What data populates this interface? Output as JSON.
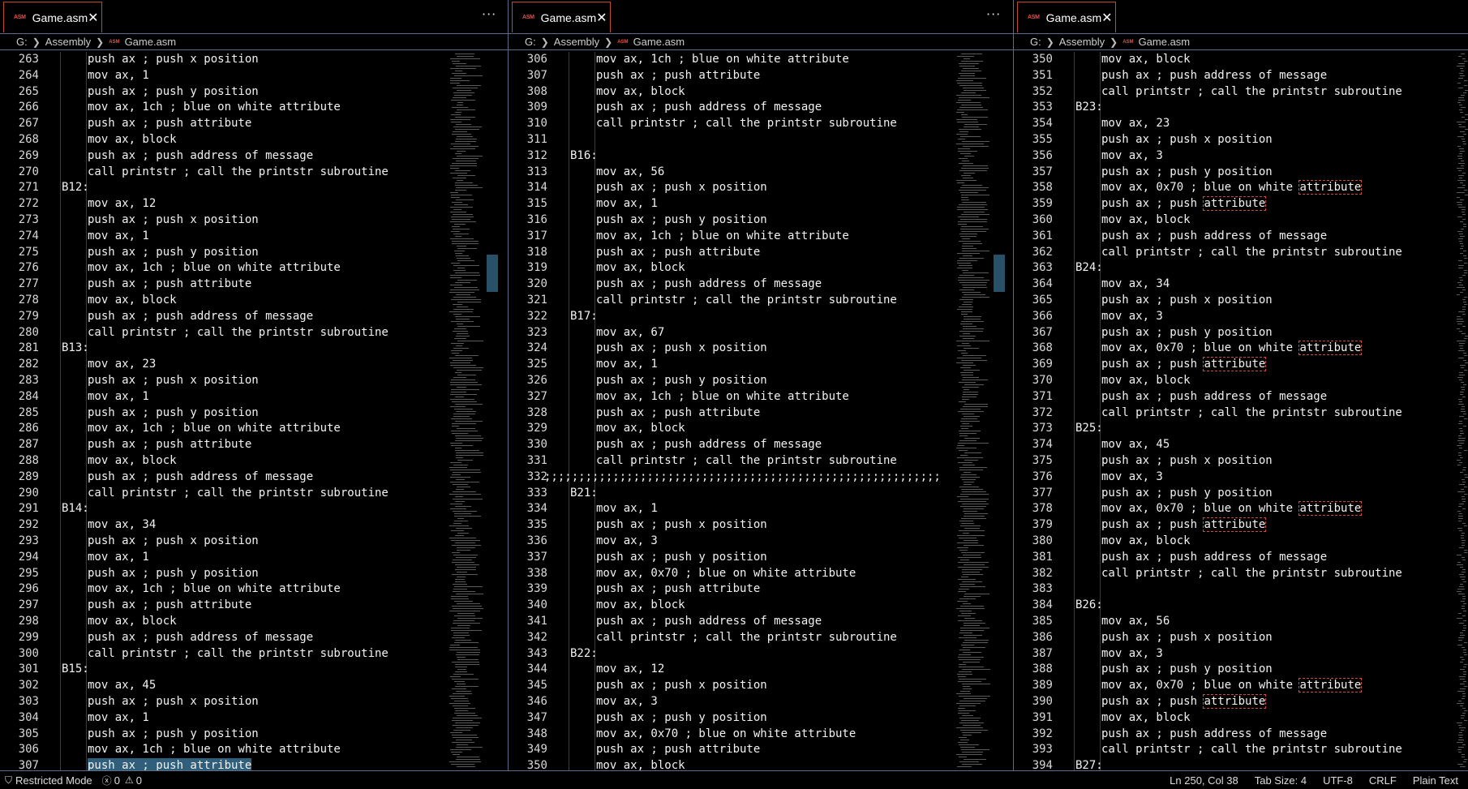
{
  "panes": [
    {
      "tab_title": "Game.asm",
      "tab_icon": "ASM",
      "breadcrumb": [
        "G:",
        "Assembly",
        "Game.asm"
      ],
      "lines": [
        {
          "n": "263",
          "t": "push ax ; push x position",
          "i": 2
        },
        {
          "n": "264",
          "t": "mov ax, 1",
          "i": 2
        },
        {
          "n": "265",
          "t": "push ax ; push y position",
          "i": 2
        },
        {
          "n": "266",
          "t": "mov ax, 1ch ; blue on white attribute",
          "i": 2
        },
        {
          "n": "267",
          "t": "push ax ; push attribute",
          "i": 2
        },
        {
          "n": "268",
          "t": "mov ax, block",
          "i": 2
        },
        {
          "n": "269",
          "t": "push ax ; push address of message",
          "i": 2
        },
        {
          "n": "270",
          "t": "call printstr ; call the printstr subroutine",
          "i": 2
        },
        {
          "n": "271",
          "t": "B12:",
          "i": 1
        },
        {
          "n": "272",
          "t": "mov ax, 12",
          "i": 2
        },
        {
          "n": "273",
          "t": "push ax ; push x position",
          "i": 2
        },
        {
          "n": "274",
          "t": "mov ax, 1",
          "i": 2
        },
        {
          "n": "275",
          "t": "push ax ; push y position",
          "i": 2
        },
        {
          "n": "276",
          "t": "mov ax, 1ch ; blue on white attribute",
          "i": 2
        },
        {
          "n": "277",
          "t": "push ax ; push attribute",
          "i": 2
        },
        {
          "n": "278",
          "t": "mov ax, block",
          "i": 2
        },
        {
          "n": "279",
          "t": "push ax ; push address of message",
          "i": 2
        },
        {
          "n": "280",
          "t": "call printstr ; call the printstr subroutine",
          "i": 2
        },
        {
          "n": "281",
          "t": "B13:",
          "i": 1
        },
        {
          "n": "282",
          "t": "mov ax, 23",
          "i": 2
        },
        {
          "n": "283",
          "t": "push ax ; push x position",
          "i": 2
        },
        {
          "n": "284",
          "t": "mov ax, 1",
          "i": 2
        },
        {
          "n": "285",
          "t": "push ax ; push y position",
          "i": 2
        },
        {
          "n": "286",
          "t": "mov ax, 1ch ; blue on white attribute",
          "i": 2
        },
        {
          "n": "287",
          "t": "push ax ; push attribute",
          "i": 2
        },
        {
          "n": "288",
          "t": "mov ax, block",
          "i": 2
        },
        {
          "n": "289",
          "t": "push ax ; push address of message",
          "i": 2
        },
        {
          "n": "290",
          "t": "call printstr ; call the printstr subroutine",
          "i": 2
        },
        {
          "n": "291",
          "t": "B14:",
          "i": 1
        },
        {
          "n": "292",
          "t": "mov ax, 34",
          "i": 2
        },
        {
          "n": "293",
          "t": "push ax ; push x position",
          "i": 2
        },
        {
          "n": "294",
          "t": "mov ax, 1",
          "i": 2
        },
        {
          "n": "295",
          "t": "push ax ; push y position",
          "i": 2
        },
        {
          "n": "296",
          "t": "mov ax, 1ch ; blue on white attribute",
          "i": 2
        },
        {
          "n": "297",
          "t": "push ax ; push attribute",
          "i": 2
        },
        {
          "n": "298",
          "t": "mov ax, block",
          "i": 2
        },
        {
          "n": "299",
          "t": "push ax ; push address of message",
          "i": 2
        },
        {
          "n": "300",
          "t": "call printstr ; call the printstr subroutine",
          "i": 2
        },
        {
          "n": "301",
          "t": "B15:",
          "i": 1
        },
        {
          "n": "302",
          "t": "mov ax, 45",
          "i": 2
        },
        {
          "n": "303",
          "t": "push ax ; push x position",
          "i": 2
        },
        {
          "n": "304",
          "t": "mov ax, 1",
          "i": 2
        },
        {
          "n": "305",
          "t": "push ax ; push y position",
          "i": 2
        },
        {
          "n": "306",
          "t": "mov ax, 1ch ; blue on white attribute",
          "i": 2
        },
        {
          "n": "307",
          "t": "push ax ; push attribute",
          "i": 2,
          "sel": true
        }
      ]
    },
    {
      "tab_title": "Game.asm",
      "tab_icon": "ASM",
      "breadcrumb": [
        "G:",
        "Assembly",
        "Game.asm"
      ],
      "lines": [
        {
          "n": "306",
          "t": "mov ax, 1ch ; blue on white attribute",
          "i": 2
        },
        {
          "n": "307",
          "t": "push ax ; push attribute",
          "i": 2
        },
        {
          "n": "308",
          "t": "mov ax, block",
          "i": 2
        },
        {
          "n": "309",
          "t": "push ax ; push address of message",
          "i": 2
        },
        {
          "n": "310",
          "t": "call printstr ; call the printstr subroutine",
          "i": 2
        },
        {
          "n": "311",
          "t": "",
          "i": 1
        },
        {
          "n": "312",
          "t": "B16:",
          "i": 1
        },
        {
          "n": "313",
          "t": "mov ax, 56",
          "i": 2
        },
        {
          "n": "314",
          "t": "push ax ; push x position",
          "i": 2
        },
        {
          "n": "315",
          "t": "mov ax, 1",
          "i": 2
        },
        {
          "n": "316",
          "t": "push ax ; push y position",
          "i": 2
        },
        {
          "n": "317",
          "t": "mov ax, 1ch ; blue on white attribute",
          "i": 2
        },
        {
          "n": "318",
          "t": "push ax ; push attribute",
          "i": 2
        },
        {
          "n": "319",
          "t": "mov ax, block",
          "i": 2
        },
        {
          "n": "320",
          "t": "push ax ; push address of message",
          "i": 2
        },
        {
          "n": "321",
          "t": "call printstr ; call the printstr subroutine",
          "i": 2
        },
        {
          "n": "322",
          "t": "B17:",
          "i": 1
        },
        {
          "n": "323",
          "t": "mov ax, 67",
          "i": 2
        },
        {
          "n": "324",
          "t": "push ax ; push x position",
          "i": 2
        },
        {
          "n": "325",
          "t": "mov ax, 1",
          "i": 2
        },
        {
          "n": "326",
          "t": "push ax ; push y position",
          "i": 2
        },
        {
          "n": "327",
          "t": "mov ax, 1ch ; blue on white attribute",
          "i": 2
        },
        {
          "n": "328",
          "t": "push ax ; push attribute",
          "i": 2
        },
        {
          "n": "329",
          "t": "mov ax, block",
          "i": 2
        },
        {
          "n": "330",
          "t": "push ax ; push address of message",
          "i": 2
        },
        {
          "n": "331",
          "t": "call printstr ; call the printstr subroutine",
          "i": 2
        },
        {
          "n": "332",
          "t": ";;;;;;;;;;;;;;;;;;;;;;;;;;;;;;;;;;;;;;;;;;;;;;;;;;;;;;;;;;",
          "i": 0
        },
        {
          "n": "333",
          "t": "B21:",
          "i": 1
        },
        {
          "n": "334",
          "t": "mov ax, 1",
          "i": 2
        },
        {
          "n": "335",
          "t": "push ax ; push x position",
          "i": 2
        },
        {
          "n": "336",
          "t": "mov ax, 3",
          "i": 2
        },
        {
          "n": "337",
          "t": "push ax ; push y position",
          "i": 2
        },
        {
          "n": "338",
          "t": "mov ax, 0x70 ; blue on white attribute",
          "i": 2
        },
        {
          "n": "339",
          "t": "push ax ; push attribute",
          "i": 2
        },
        {
          "n": "340",
          "t": "mov ax, block",
          "i": 2
        },
        {
          "n": "341",
          "t": "push ax ; push address of message",
          "i": 2
        },
        {
          "n": "342",
          "t": "call printstr ; call the printstr subroutine",
          "i": 2
        },
        {
          "n": "343",
          "t": "B22:",
          "i": 1
        },
        {
          "n": "344",
          "t": "mov ax, 12",
          "i": 2
        },
        {
          "n": "345",
          "t": "push ax ; push x position",
          "i": 2
        },
        {
          "n": "346",
          "t": "mov ax, 3",
          "i": 2
        },
        {
          "n": "347",
          "t": "push ax ; push y position",
          "i": 2
        },
        {
          "n": "348",
          "t": "mov ax, 0x70 ; blue on white attribute",
          "i": 2
        },
        {
          "n": "349",
          "t": "push ax ; push attribute",
          "i": 2
        },
        {
          "n": "350",
          "t": "mov ax, block",
          "i": 2
        }
      ]
    },
    {
      "tab_title": "Game.asm",
      "tab_icon": "ASM",
      "breadcrumb": [
        "G:",
        "Assembly",
        "Game.asm"
      ],
      "lines": [
        {
          "n": "350",
          "t": "mov ax, block",
          "i": 2
        },
        {
          "n": "351",
          "t": "push ax ; push address of message",
          "i": 2
        },
        {
          "n": "352",
          "t": "call printstr ; call the printstr subroutine",
          "i": 2
        },
        {
          "n": "353",
          "t": "B23:",
          "i": 1
        },
        {
          "n": "354",
          "t": "mov ax, 23",
          "i": 2
        },
        {
          "n": "355",
          "t": "push ax ; push x position",
          "i": 2
        },
        {
          "n": "356",
          "t": "mov ax, 3",
          "i": 2
        },
        {
          "n": "357",
          "t": "push ax ; push y position",
          "i": 2
        },
        {
          "n": "358",
          "t": "mov ax, 0x70 ; blue on white attribute",
          "i": 2,
          "hl": "attribute"
        },
        {
          "n": "359",
          "t": "push ax ; push attribute",
          "i": 2,
          "hl": "attribute"
        },
        {
          "n": "360",
          "t": "mov ax, block",
          "i": 2
        },
        {
          "n": "361",
          "t": "push ax ; push address of message",
          "i": 2
        },
        {
          "n": "362",
          "t": "call printstr ; call the printstr subroutine",
          "i": 2
        },
        {
          "n": "363",
          "t": "B24:",
          "i": 1
        },
        {
          "n": "364",
          "t": "mov ax, 34",
          "i": 2
        },
        {
          "n": "365",
          "t": "push ax ; push x position",
          "i": 2
        },
        {
          "n": "366",
          "t": "mov ax, 3",
          "i": 2
        },
        {
          "n": "367",
          "t": "push ax ; push y position",
          "i": 2
        },
        {
          "n": "368",
          "t": "mov ax, 0x70 ; blue on white attribute",
          "i": 2,
          "hl": "attribute"
        },
        {
          "n": "369",
          "t": "push ax ; push attribute",
          "i": 2,
          "hl": "attribute"
        },
        {
          "n": "370",
          "t": "mov ax, block",
          "i": 2
        },
        {
          "n": "371",
          "t": "push ax ; push address of message",
          "i": 2
        },
        {
          "n": "372",
          "t": "call printstr ; call the printstr subroutine",
          "i": 2
        },
        {
          "n": "373",
          "t": "B25:",
          "i": 1
        },
        {
          "n": "374",
          "t": "mov ax, 45",
          "i": 2
        },
        {
          "n": "375",
          "t": "push ax ; push x position",
          "i": 2
        },
        {
          "n": "376",
          "t": "mov ax, 3",
          "i": 2
        },
        {
          "n": "377",
          "t": "push ax ; push y position",
          "i": 2
        },
        {
          "n": "378",
          "t": "mov ax, 0x70 ; blue on white attribute",
          "i": 2,
          "hl": "attribute"
        },
        {
          "n": "379",
          "t": "push ax ; push attribute",
          "i": 2,
          "hl": "attribute"
        },
        {
          "n": "380",
          "t": "mov ax, block",
          "i": 2
        },
        {
          "n": "381",
          "t": "push ax ; push address of message",
          "i": 2
        },
        {
          "n": "382",
          "t": "call printstr ; call the printstr subroutine",
          "i": 2
        },
        {
          "n": "383",
          "t": "",
          "i": 1
        },
        {
          "n": "384",
          "t": "B26:",
          "i": 1
        },
        {
          "n": "385",
          "t": "mov ax, 56",
          "i": 2
        },
        {
          "n": "386",
          "t": "push ax ; push x position",
          "i": 2
        },
        {
          "n": "387",
          "t": "mov ax, 3",
          "i": 2
        },
        {
          "n": "388",
          "t": "push ax ; push y position",
          "i": 2
        },
        {
          "n": "389",
          "t": "mov ax, 0x70 ; blue on white attribute",
          "i": 2,
          "hl": "attribute"
        },
        {
          "n": "390",
          "t": "push ax ; push attribute",
          "i": 2,
          "hl": "attribute"
        },
        {
          "n": "391",
          "t": "mov ax, block",
          "i": 2
        },
        {
          "n": "392",
          "t": "push ax ; push address of message",
          "i": 2
        },
        {
          "n": "393",
          "t": "call printstr ; call the printstr subroutine",
          "i": 2
        },
        {
          "n": "394",
          "t": "B27:",
          "i": 1
        }
      ]
    }
  ],
  "status": {
    "restricted_mode": "Restricted Mode",
    "errors": "0",
    "warnings": "0",
    "cursor": "Ln 250, Col 38",
    "tab_size": "Tab Size: 4",
    "encoding": "UTF-8",
    "eol": "CRLF",
    "language": "Plain Text"
  },
  "colors": {
    "accent_border": "#c04a2a",
    "pane_border": "#5a6b8c",
    "selection": "#2f5f7a",
    "find_highlight": "#d04a3a"
  }
}
